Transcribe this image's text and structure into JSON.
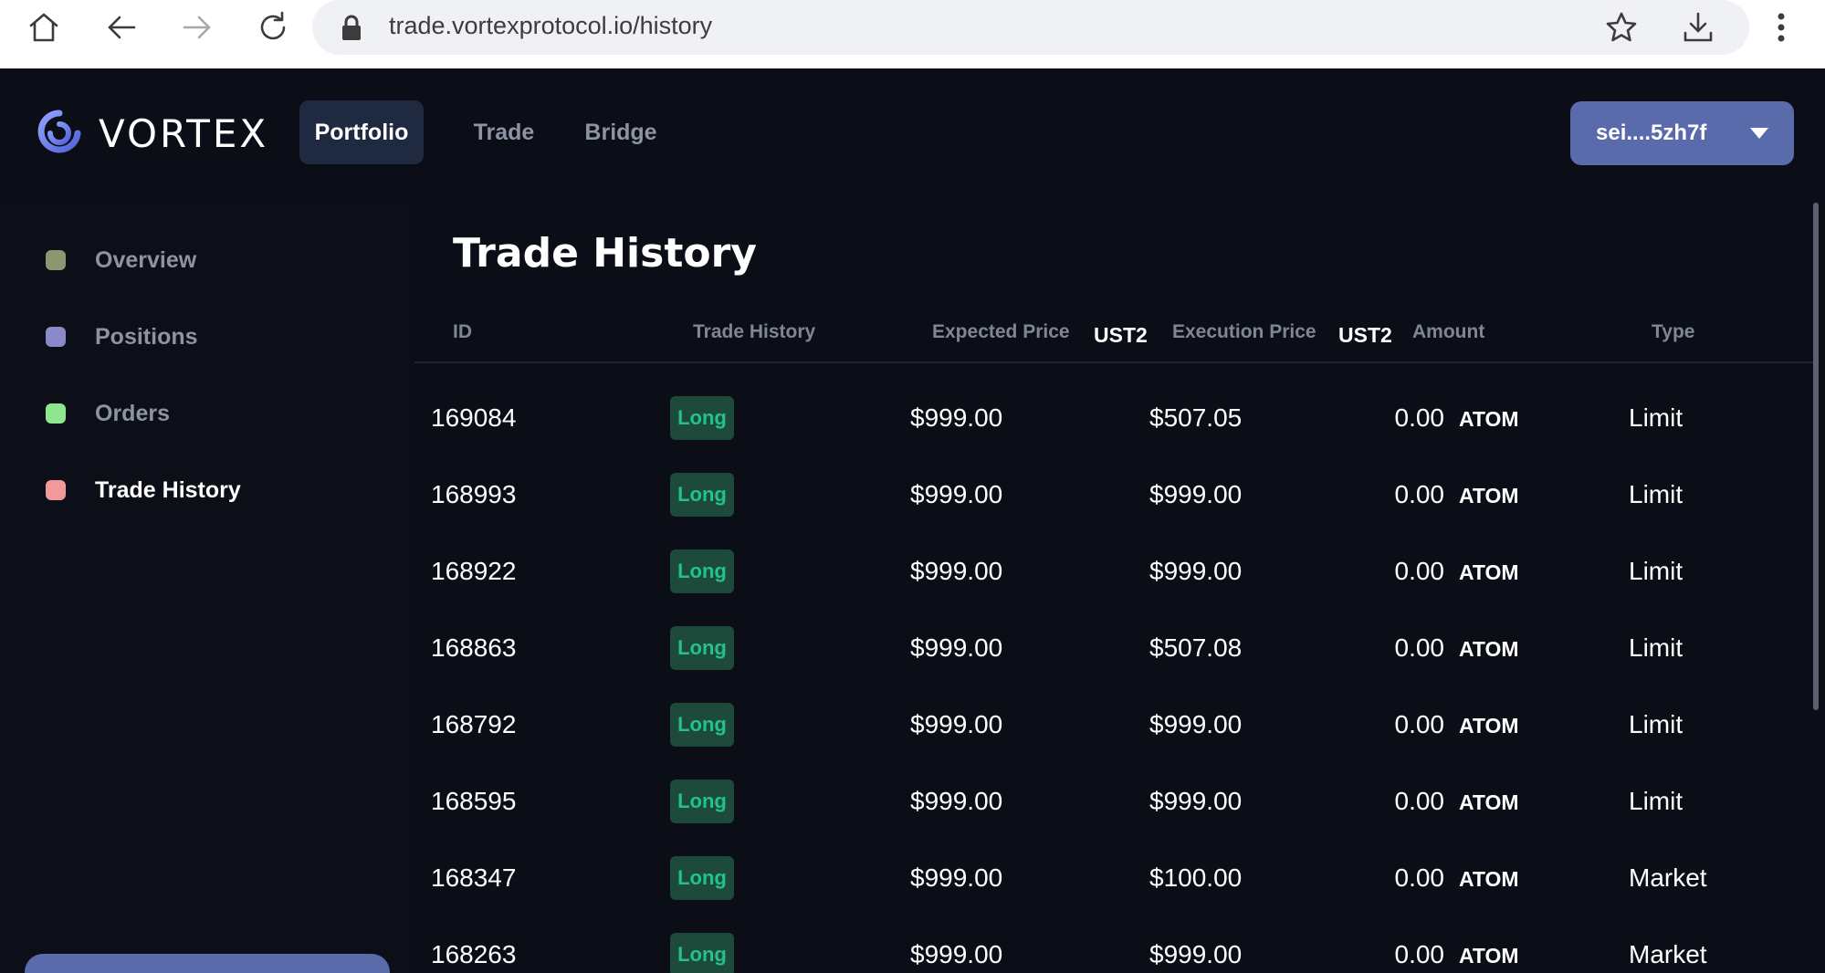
{
  "browser": {
    "url": "trade.vortexprotocol.io/history",
    "icons": [
      "home-icon",
      "back-icon",
      "forward-icon",
      "reload-icon",
      "lock-icon",
      "star-icon",
      "download-icon",
      "more-vert-icon"
    ]
  },
  "header": {
    "brand": "VORTEX",
    "tabs": [
      {
        "label": "Portfolio",
        "active": true
      },
      {
        "label": "Trade",
        "active": false
      },
      {
        "label": "Bridge",
        "active": false
      }
    ],
    "wallet": "sei....5zh7f"
  },
  "sidebar": {
    "items": [
      {
        "label": "Overview",
        "color": "#8e9670",
        "active": false
      },
      {
        "label": "Positions",
        "color": "#8a8ac9",
        "active": false
      },
      {
        "label": "Orders",
        "color": "#8ee68e",
        "active": false
      },
      {
        "label": "Trade History",
        "color": "#f29a9a",
        "active": true
      }
    ]
  },
  "main": {
    "title": "Trade History",
    "columns": {
      "id": "ID",
      "trade_history": "Trade History",
      "expected_price": "Expected Price",
      "expected_unit": "UST2",
      "execution_price": "Execution Price",
      "execution_unit": "UST2",
      "amount": "Amount",
      "type": "Type"
    },
    "rows": [
      {
        "id": "169084",
        "side": "Long",
        "expected": "$999.00",
        "execution": "$507.05",
        "amount": "0.00",
        "unit": "ATOM",
        "type": "Limit"
      },
      {
        "id": "168993",
        "side": "Long",
        "expected": "$999.00",
        "execution": "$999.00",
        "amount": "0.00",
        "unit": "ATOM",
        "type": "Limit"
      },
      {
        "id": "168922",
        "side": "Long",
        "expected": "$999.00",
        "execution": "$999.00",
        "amount": "0.00",
        "unit": "ATOM",
        "type": "Limit"
      },
      {
        "id": "168863",
        "side": "Long",
        "expected": "$999.00",
        "execution": "$507.08",
        "amount": "0.00",
        "unit": "ATOM",
        "type": "Limit"
      },
      {
        "id": "168792",
        "side": "Long",
        "expected": "$999.00",
        "execution": "$999.00",
        "amount": "0.00",
        "unit": "ATOM",
        "type": "Limit"
      },
      {
        "id": "168595",
        "side": "Long",
        "expected": "$999.00",
        "execution": "$999.00",
        "amount": "0.00",
        "unit": "ATOM",
        "type": "Limit"
      },
      {
        "id": "168347",
        "side": "Long",
        "expected": "$999.00",
        "execution": "$100.00",
        "amount": "0.00",
        "unit": "ATOM",
        "type": "Market"
      },
      {
        "id": "168263",
        "side": "Long",
        "expected": "$999.00",
        "execution": "$999.00",
        "amount": "0.00",
        "unit": "ATOM",
        "type": "Market"
      }
    ]
  },
  "colors": {
    "background": "#0b0e16",
    "accent": "#5a6bab",
    "long_badge_bg": "#1d4a3b",
    "long_badge_text": "#22c28a"
  }
}
